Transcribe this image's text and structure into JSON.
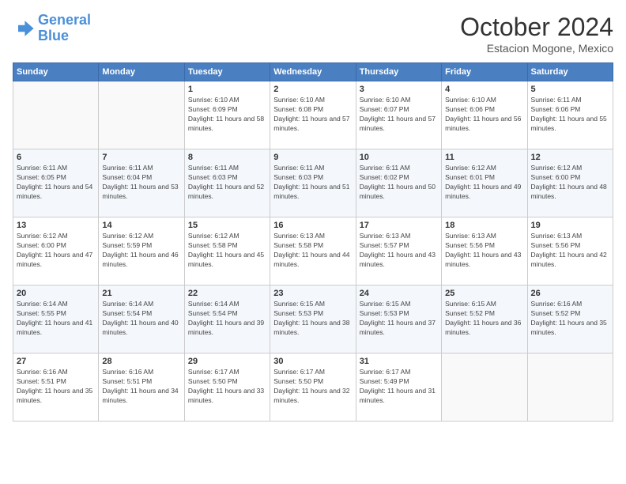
{
  "logo": {
    "line1": "General",
    "line2": "Blue"
  },
  "title": "October 2024",
  "subtitle": "Estacion Mogone, Mexico",
  "weekdays": [
    "Sunday",
    "Monday",
    "Tuesday",
    "Wednesday",
    "Thursday",
    "Friday",
    "Saturday"
  ],
  "weeks": [
    [
      {
        "day": "",
        "sunrise": "",
        "sunset": "",
        "daylight": ""
      },
      {
        "day": "",
        "sunrise": "",
        "sunset": "",
        "daylight": ""
      },
      {
        "day": "1",
        "sunrise": "Sunrise: 6:10 AM",
        "sunset": "Sunset: 6:09 PM",
        "daylight": "Daylight: 11 hours and 58 minutes."
      },
      {
        "day": "2",
        "sunrise": "Sunrise: 6:10 AM",
        "sunset": "Sunset: 6:08 PM",
        "daylight": "Daylight: 11 hours and 57 minutes."
      },
      {
        "day": "3",
        "sunrise": "Sunrise: 6:10 AM",
        "sunset": "Sunset: 6:07 PM",
        "daylight": "Daylight: 11 hours and 57 minutes."
      },
      {
        "day": "4",
        "sunrise": "Sunrise: 6:10 AM",
        "sunset": "Sunset: 6:06 PM",
        "daylight": "Daylight: 11 hours and 56 minutes."
      },
      {
        "day": "5",
        "sunrise": "Sunrise: 6:11 AM",
        "sunset": "Sunset: 6:06 PM",
        "daylight": "Daylight: 11 hours and 55 minutes."
      }
    ],
    [
      {
        "day": "6",
        "sunrise": "Sunrise: 6:11 AM",
        "sunset": "Sunset: 6:05 PM",
        "daylight": "Daylight: 11 hours and 54 minutes."
      },
      {
        "day": "7",
        "sunrise": "Sunrise: 6:11 AM",
        "sunset": "Sunset: 6:04 PM",
        "daylight": "Daylight: 11 hours and 53 minutes."
      },
      {
        "day": "8",
        "sunrise": "Sunrise: 6:11 AM",
        "sunset": "Sunset: 6:03 PM",
        "daylight": "Daylight: 11 hours and 52 minutes."
      },
      {
        "day": "9",
        "sunrise": "Sunrise: 6:11 AM",
        "sunset": "Sunset: 6:03 PM",
        "daylight": "Daylight: 11 hours and 51 minutes."
      },
      {
        "day": "10",
        "sunrise": "Sunrise: 6:11 AM",
        "sunset": "Sunset: 6:02 PM",
        "daylight": "Daylight: 11 hours and 50 minutes."
      },
      {
        "day": "11",
        "sunrise": "Sunrise: 6:12 AM",
        "sunset": "Sunset: 6:01 PM",
        "daylight": "Daylight: 11 hours and 49 minutes."
      },
      {
        "day": "12",
        "sunrise": "Sunrise: 6:12 AM",
        "sunset": "Sunset: 6:00 PM",
        "daylight": "Daylight: 11 hours and 48 minutes."
      }
    ],
    [
      {
        "day": "13",
        "sunrise": "Sunrise: 6:12 AM",
        "sunset": "Sunset: 6:00 PM",
        "daylight": "Daylight: 11 hours and 47 minutes."
      },
      {
        "day": "14",
        "sunrise": "Sunrise: 6:12 AM",
        "sunset": "Sunset: 5:59 PM",
        "daylight": "Daylight: 11 hours and 46 minutes."
      },
      {
        "day": "15",
        "sunrise": "Sunrise: 6:12 AM",
        "sunset": "Sunset: 5:58 PM",
        "daylight": "Daylight: 11 hours and 45 minutes."
      },
      {
        "day": "16",
        "sunrise": "Sunrise: 6:13 AM",
        "sunset": "Sunset: 5:58 PM",
        "daylight": "Daylight: 11 hours and 44 minutes."
      },
      {
        "day": "17",
        "sunrise": "Sunrise: 6:13 AM",
        "sunset": "Sunset: 5:57 PM",
        "daylight": "Daylight: 11 hours and 43 minutes."
      },
      {
        "day": "18",
        "sunrise": "Sunrise: 6:13 AM",
        "sunset": "Sunset: 5:56 PM",
        "daylight": "Daylight: 11 hours and 43 minutes."
      },
      {
        "day": "19",
        "sunrise": "Sunrise: 6:13 AM",
        "sunset": "Sunset: 5:56 PM",
        "daylight": "Daylight: 11 hours and 42 minutes."
      }
    ],
    [
      {
        "day": "20",
        "sunrise": "Sunrise: 6:14 AM",
        "sunset": "Sunset: 5:55 PM",
        "daylight": "Daylight: 11 hours and 41 minutes."
      },
      {
        "day": "21",
        "sunrise": "Sunrise: 6:14 AM",
        "sunset": "Sunset: 5:54 PM",
        "daylight": "Daylight: 11 hours and 40 minutes."
      },
      {
        "day": "22",
        "sunrise": "Sunrise: 6:14 AM",
        "sunset": "Sunset: 5:54 PM",
        "daylight": "Daylight: 11 hours and 39 minutes."
      },
      {
        "day": "23",
        "sunrise": "Sunrise: 6:15 AM",
        "sunset": "Sunset: 5:53 PM",
        "daylight": "Daylight: 11 hours and 38 minutes."
      },
      {
        "day": "24",
        "sunrise": "Sunrise: 6:15 AM",
        "sunset": "Sunset: 5:53 PM",
        "daylight": "Daylight: 11 hours and 37 minutes."
      },
      {
        "day": "25",
        "sunrise": "Sunrise: 6:15 AM",
        "sunset": "Sunset: 5:52 PM",
        "daylight": "Daylight: 11 hours and 36 minutes."
      },
      {
        "day": "26",
        "sunrise": "Sunrise: 6:16 AM",
        "sunset": "Sunset: 5:52 PM",
        "daylight": "Daylight: 11 hours and 35 minutes."
      }
    ],
    [
      {
        "day": "27",
        "sunrise": "Sunrise: 6:16 AM",
        "sunset": "Sunset: 5:51 PM",
        "daylight": "Daylight: 11 hours and 35 minutes."
      },
      {
        "day": "28",
        "sunrise": "Sunrise: 6:16 AM",
        "sunset": "Sunset: 5:51 PM",
        "daylight": "Daylight: 11 hours and 34 minutes."
      },
      {
        "day": "29",
        "sunrise": "Sunrise: 6:17 AM",
        "sunset": "Sunset: 5:50 PM",
        "daylight": "Daylight: 11 hours and 33 minutes."
      },
      {
        "day": "30",
        "sunrise": "Sunrise: 6:17 AM",
        "sunset": "Sunset: 5:50 PM",
        "daylight": "Daylight: 11 hours and 32 minutes."
      },
      {
        "day": "31",
        "sunrise": "Sunrise: 6:17 AM",
        "sunset": "Sunset: 5:49 PM",
        "daylight": "Daylight: 11 hours and 31 minutes."
      },
      {
        "day": "",
        "sunrise": "",
        "sunset": "",
        "daylight": ""
      },
      {
        "day": "",
        "sunrise": "",
        "sunset": "",
        "daylight": ""
      }
    ]
  ]
}
